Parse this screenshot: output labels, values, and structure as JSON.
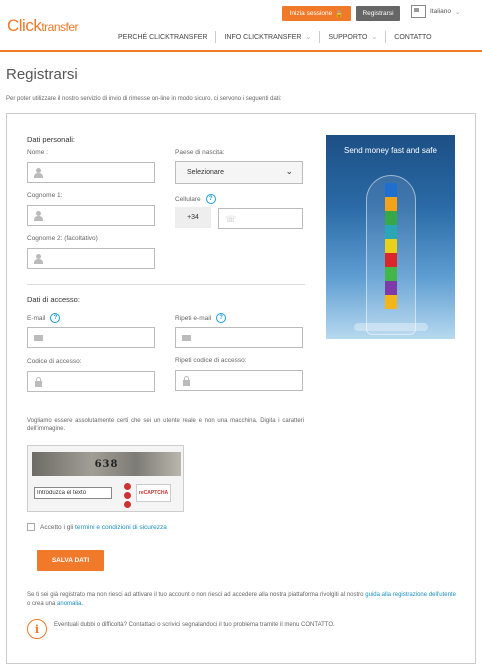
{
  "brand": {
    "name_part1": "Click",
    "name_part2": "transfer"
  },
  "header": {
    "login_label": "Inizia sessione",
    "register_label": "Registrarsi",
    "language": "Italiano"
  },
  "nav": [
    {
      "label": "PERCHÉ CLICKTRANSFER"
    },
    {
      "label": "INFO CLICKTRANSFER"
    },
    {
      "label": "SUPPORTO"
    },
    {
      "label": "CONTATTO"
    }
  ],
  "page": {
    "title": "Registrarsi",
    "intro": "Per poter utilizzare il nostro servizio di invio di rimesse on-line in modo sicuro, ci servono i seguenti dati:"
  },
  "personal": {
    "section_title": "Dati personali:",
    "name_label": "Nome :",
    "surname1_label": "Cognome 1:",
    "surname2_label": "Cognome 2: (facoltativo)",
    "country_label": "Paese di nascita:",
    "country_value": "Selezionare",
    "mobile_label": "Cellulare",
    "mobile_prefix": "+34"
  },
  "access": {
    "section_title": "Dati di accesso:",
    "email_label": "E-mail",
    "email_repeat_label": "Ripeti e-mail",
    "code_label": "Codice di accesso:",
    "code_repeat_label": "Ripeti codice di accesso:"
  },
  "promo": {
    "text": "Send money fast and safe"
  },
  "captcha": {
    "intro": "Vogliamo essere assolutamente certi che sei un utente reale e non una macchina. Digita i caratteri dell'immagine.",
    "image_text": "638",
    "input_value": "Introduzca el texto",
    "logo": "reCAPTCHA"
  },
  "terms": {
    "prefix": "Accetto i gli ",
    "link": "termini e condizioni di sicurezza"
  },
  "save_label": "SALVA DATI",
  "footer": {
    "note_text": "Se ti sei già registrato ma non riesci ad attivare il tuo account o non riesci ad accedere alla nostra piattaforma rivolgiti al nostro ",
    "note_link1": "guida alla registrazione dell'utente",
    "note_mid": " o crea una ",
    "note_link2": "anomalia",
    "note_end": ".",
    "alert_text": "Eventuali dubbi o difficoltà? Contattaci o scrivici segnalandoci il tuo problema tramite il menu CONTATTO."
  },
  "colors": {
    "accent": "#f07a2a",
    "link": "#1a8fc4",
    "dark_button": "#666666"
  }
}
